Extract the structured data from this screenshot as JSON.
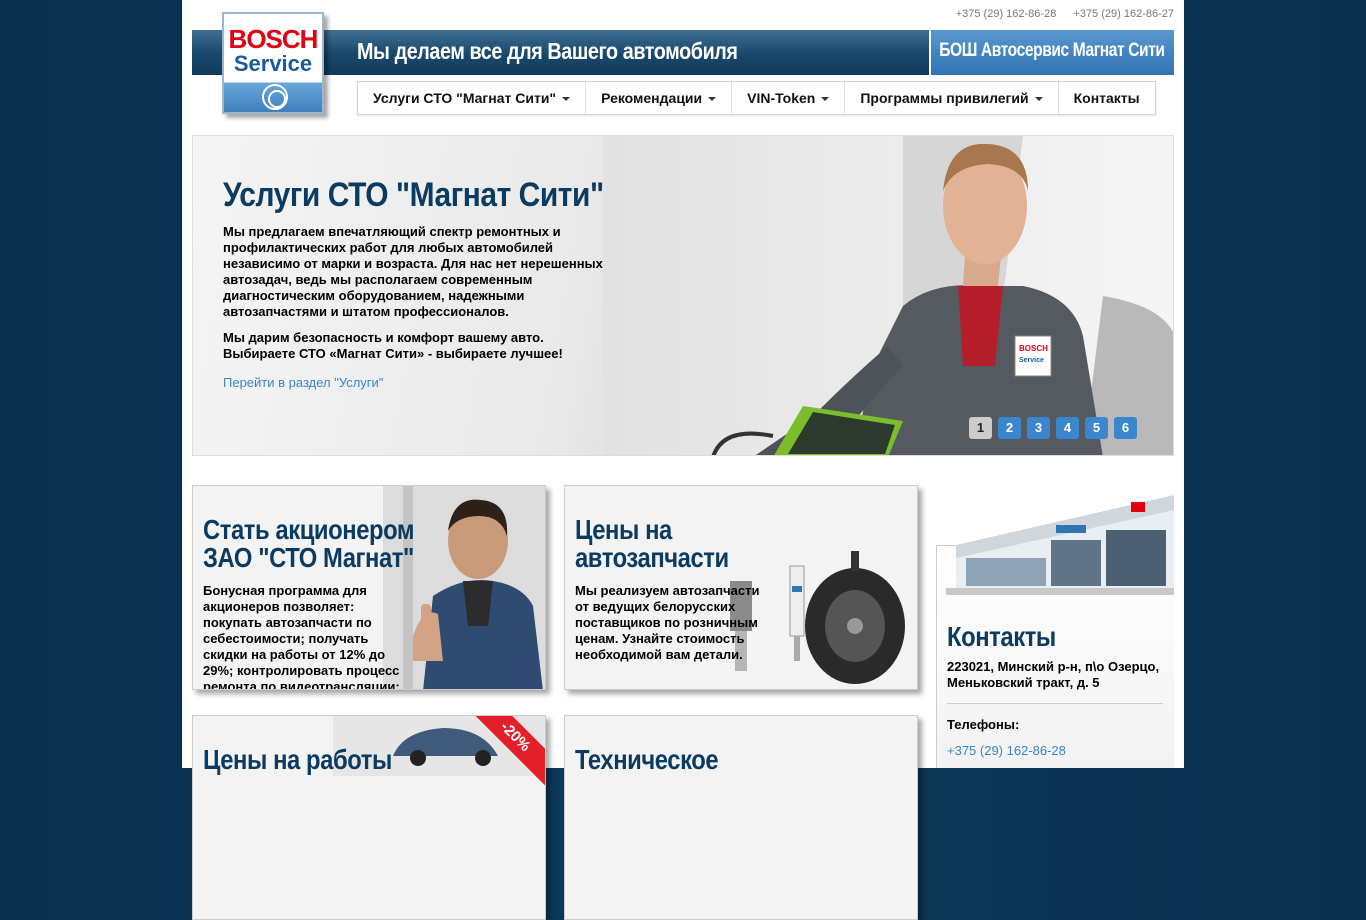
{
  "header": {
    "phones": [
      "+375 (29) 162-86-28",
      "+375 (29) 162-86-27"
    ],
    "tagline": "Мы делаем все для Вашего автомобиля",
    "brand": "БОШ Автосервис Магнат Сити",
    "logo": {
      "line1": "BOSCH",
      "line2": "Service"
    }
  },
  "nav": {
    "items": [
      {
        "label": "Услуги СТО \"Магнат Сити\"",
        "dropdown": true
      },
      {
        "label": "Рекомендации",
        "dropdown": true
      },
      {
        "label": "VIN-Token",
        "dropdown": true
      },
      {
        "label": "Программы привилегий",
        "dropdown": true
      },
      {
        "label": "Контакты",
        "dropdown": false
      }
    ]
  },
  "hero": {
    "title": "Услуги СТО \"Магнат Сити\"",
    "paragraph1": "Мы предлагаем впечатляющий спектр ремонтных и профилактических работ для любых автомобилей независимо от марки и возраста. Для нас нет нерешенных автозадач, ведь мы располагаем современным диагностическим оборудованием, надежными автозапчастями и штатом профессионалов.",
    "paragraph2": "Мы дарим безопасность и комфорт вашему авто. Выбираете СТО «Магнат Сити» - выбираете лучшее!",
    "link": "Перейти в раздел \"Услуги\"",
    "pages": [
      "1",
      "2",
      "3",
      "4",
      "5",
      "6"
    ],
    "active_page": "1"
  },
  "promos": {
    "shareholder": {
      "title_line1": "Стать акционером",
      "title_line2": "ЗАО \"СТО Магнат\"",
      "text": "Бонусная программа для акционеров позволяет: покупать автозапчасти по себестоимости; получать скидки на работы от 12% до 29%; контролировать процесс ремонта по видеотрансляции;"
    },
    "parts": {
      "title_line1": "Цены на",
      "title_line2": "автозапчасти",
      "text": "Мы реализуем автозапчасти от ведущих белорусских поставщиков по розничным ценам. Узнайте стоимость необходимой вам детали."
    },
    "works": {
      "title": "Цены на работы",
      "badge": "-20%"
    },
    "tech": {
      "title": "Техническое"
    }
  },
  "contacts": {
    "title": "Контакты",
    "address": "223021, Минский р-н, п\\о Озерцо, Меньковский тракт, д. 5",
    "phones_label": "Телефоны:",
    "phone": "+375 (29) 162-86-28"
  },
  "colors": {
    "accent": "#3b87cf",
    "heading": "#0c3b62",
    "link": "#3a86c9",
    "bosch_red": "#e20015"
  }
}
